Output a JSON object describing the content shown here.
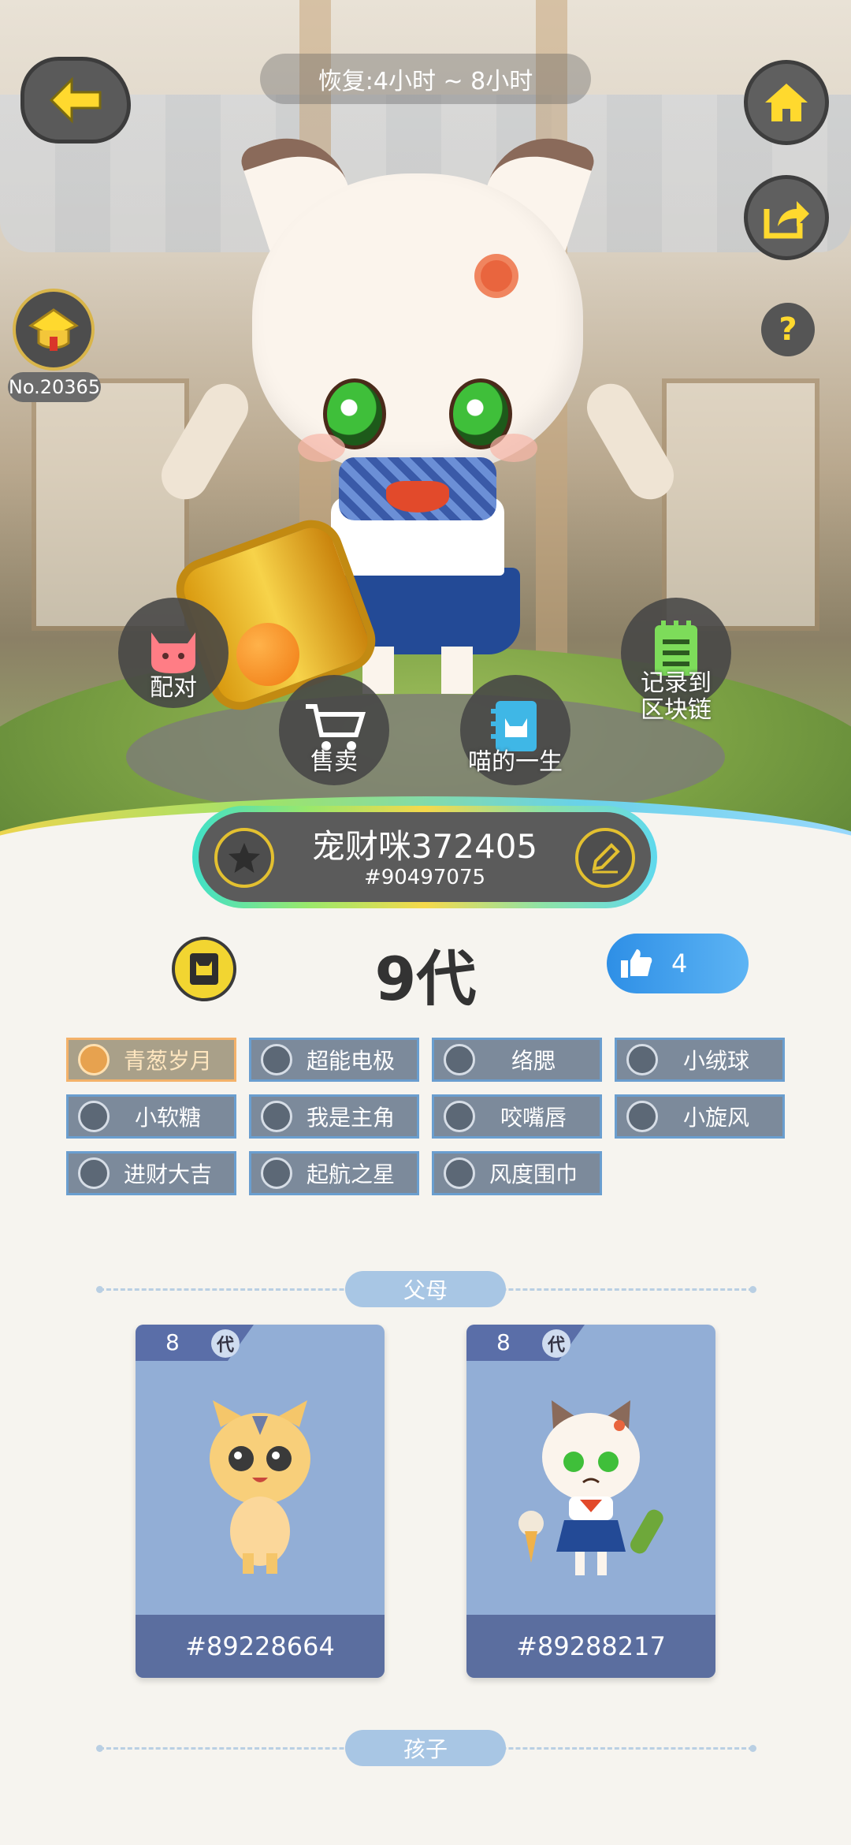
{
  "header": {
    "recovery_text": "恢复:4小时 ~ 8小时",
    "level_number": "No.20365"
  },
  "actions": {
    "pair": "配对",
    "sell": "售卖",
    "life": "喵的一生",
    "record": "记录到\n区块链"
  },
  "pet": {
    "name": "宠财咪372405",
    "id": "#90497075",
    "generation": "9代",
    "likes": "4"
  },
  "tags": [
    {
      "name": "青葱岁月",
      "active": true
    },
    {
      "name": "超能电极",
      "active": false
    },
    {
      "name": "络腮",
      "active": false
    },
    {
      "name": "小绒球",
      "active": false
    },
    {
      "name": "小软糖",
      "active": false
    },
    {
      "name": "我是主角",
      "active": false
    },
    {
      "name": "咬嘴唇",
      "active": false
    },
    {
      "name": "小旋风",
      "active": false
    },
    {
      "name": "进财大吉",
      "active": false
    },
    {
      "name": "起航之星",
      "active": false
    },
    {
      "name": "风度围巾",
      "active": false
    }
  ],
  "sections": {
    "parents": "父母",
    "children": "孩子"
  },
  "parents": [
    {
      "generation": "8",
      "gen_char": "代",
      "id": "#89228664"
    },
    {
      "generation": "8",
      "gen_char": "代",
      "id": "#89288217"
    }
  ],
  "colors": {
    "accent_yellow": "#f2d531",
    "like_blue": "#2e8fe6",
    "tag_bg": "#7c8a9b",
    "tag_active_border": "#f4b26a"
  },
  "icons": {
    "back": "arrow-left-icon",
    "home": "home-icon",
    "share": "share-icon",
    "help": "question-icon",
    "star": "star-icon",
    "edit": "pencil-icon",
    "doc": "document-icon",
    "like": "thumbs-up-icon"
  }
}
